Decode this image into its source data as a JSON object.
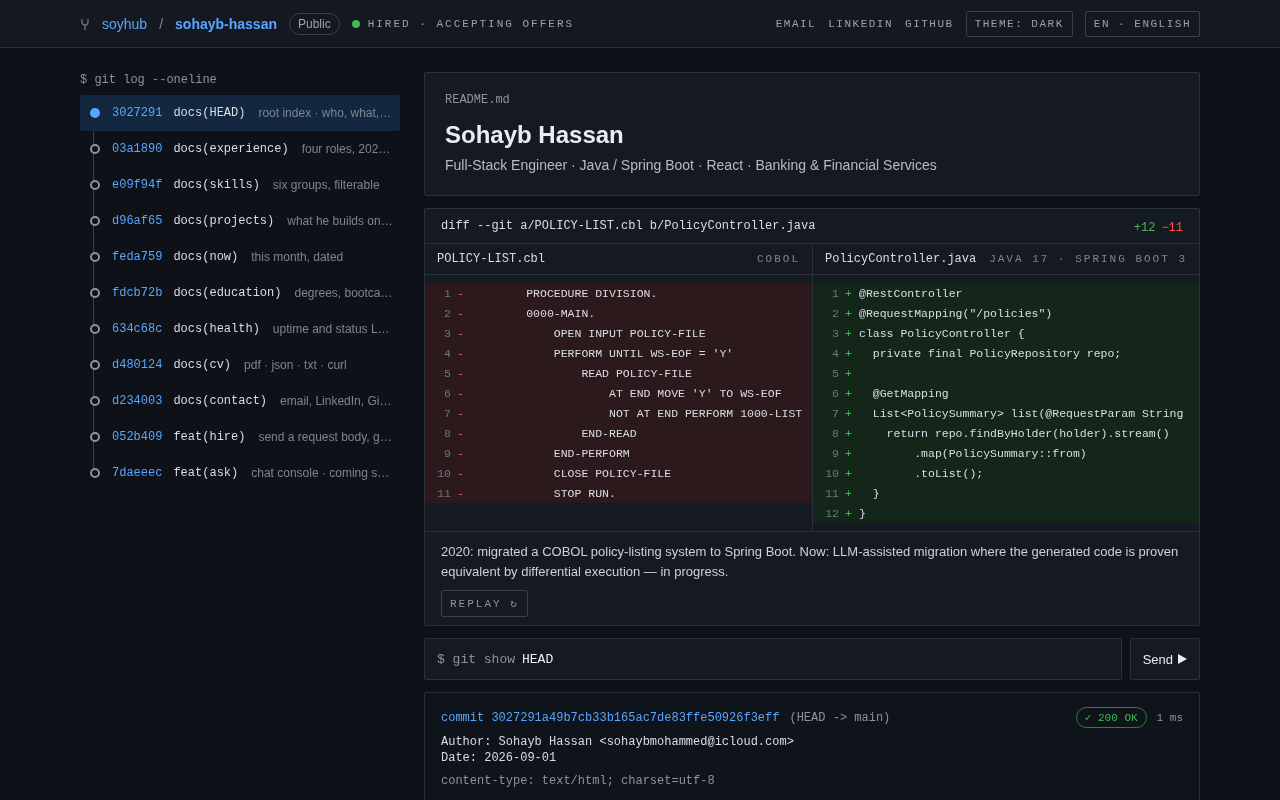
{
  "header": {
    "owner": "soyhub",
    "separator": "/",
    "repo": "sohayb-hassan",
    "visibility": "Public",
    "status": {
      "label": "HIRED · ACCEPTING OFFERS",
      "online": true
    },
    "links": [
      "EMAIL",
      "LINKEDIN",
      "GITHUB"
    ],
    "buttons": [
      "THEME: DARK",
      "EN · ENGLISH"
    ]
  },
  "sidebar": {
    "prompt": "$ git log --oneline",
    "commits": [
      {
        "hash": "3027291",
        "subject": "docs(HEAD)",
        "description": "root index · who, what,…",
        "selected": true
      },
      {
        "hash": "03a1890",
        "subject": "docs(experience)",
        "description": "four roles, 202…",
        "selected": false
      },
      {
        "hash": "e09f94f",
        "subject": "docs(skills)",
        "description": "six groups, filterable",
        "selected": false
      },
      {
        "hash": "d96af65",
        "subject": "docs(projects)",
        "description": "what he builds on…",
        "selected": false
      },
      {
        "hash": "feda759",
        "subject": "docs(now)",
        "description": "this month, dated",
        "selected": false
      },
      {
        "hash": "fdcb72b",
        "subject": "docs(education)",
        "description": "degrees, bootca…",
        "selected": false
      },
      {
        "hash": "634c68c",
        "subject": "docs(health)",
        "description": "uptime and status L…",
        "selected": false
      },
      {
        "hash": "d480124",
        "subject": "docs(cv)",
        "description": "pdf · json · txt · curl",
        "selected": false
      },
      {
        "hash": "d234003",
        "subject": "docs(contact)",
        "description": "email, LinkedIn, Gi…",
        "selected": false
      },
      {
        "hash": "052b409",
        "subject": "feat(hire)",
        "description": "send a request body, g…",
        "selected": false
      },
      {
        "hash": "7daeeec",
        "subject": "feat(ask)",
        "description": "chat console · coming s…",
        "selected": false
      }
    ]
  },
  "readme": {
    "filename": "README.md",
    "title": "Sohayb Hassan",
    "subtitle": "Full-Stack Engineer · Java / Spring Boot · React · Banking & Financial Services"
  },
  "diff": {
    "command": "diff --git a/POLICY-LIST.cbl b/PolicyController.java",
    "additions": "+12",
    "deletions": "−11",
    "left": {
      "filename": "POLICY-LIST.cbl",
      "language": "COBOL",
      "lines": [
        {
          "number": "1",
          "sign": "-",
          "code": "        PROCEDURE DIVISION."
        },
        {
          "number": "2",
          "sign": "-",
          "code": "        0000-MAIN."
        },
        {
          "number": "3",
          "sign": "-",
          "code": "            OPEN INPUT POLICY-FILE"
        },
        {
          "number": "4",
          "sign": "-",
          "code": "            PERFORM UNTIL WS-EOF = 'Y'"
        },
        {
          "number": "5",
          "sign": "-",
          "code": "                READ POLICY-FILE"
        },
        {
          "number": "6",
          "sign": "-",
          "code": "                    AT END MOVE 'Y' TO WS-EOF"
        },
        {
          "number": "7",
          "sign": "-",
          "code": "                    NOT AT END PERFORM 1000-LIST"
        },
        {
          "number": "8",
          "sign": "-",
          "code": "                END-READ"
        },
        {
          "number": "9",
          "sign": "-",
          "code": "            END-PERFORM"
        },
        {
          "number": "10",
          "sign": "-",
          "code": "            CLOSE POLICY-FILE"
        },
        {
          "number": "11",
          "sign": "-",
          "code": "            STOP RUN."
        }
      ]
    },
    "right": {
      "filename": "PolicyController.java",
      "language": "JAVA 17 · SPRING BOOT 3",
      "lines": [
        {
          "number": "1",
          "sign": "+",
          "code": "@RestController"
        },
        {
          "number": "2",
          "sign": "+",
          "code": "@RequestMapping(\"/policies\")"
        },
        {
          "number": "3",
          "sign": "+",
          "code": "class PolicyController {"
        },
        {
          "number": "4",
          "sign": "+",
          "code": "  private final PolicyRepository repo;"
        },
        {
          "number": "5",
          "sign": "+"
        },
        {
          "number": "6",
          "sign": "+",
          "code": "  @GetMapping"
        },
        {
          "number": "7",
          "sign": "+",
          "code": "  List<PolicySummary> list(@RequestParam String"
        },
        {
          "number": "8",
          "sign": "+",
          "code": "    return repo.findByHolder(holder).stream()"
        },
        {
          "number": "9",
          "sign": "+",
          "code": "        .map(PolicySummary::from)"
        },
        {
          "number": "10",
          "sign": "+",
          "code": "        .toList();"
        },
        {
          "number": "11",
          "sign": "+",
          "code": "  }"
        },
        {
          "number": "12",
          "sign": "+",
          "code": "}"
        }
      ]
    },
    "note": "2020: migrated a COBOL policy-listing system to Spring Boot. Now: LLM-assisted migration where the generated code is proven equivalent by differential execution — in progress.",
    "replay": "REPLAY ↻"
  },
  "console": {
    "prefix": "$ git show",
    "value": "HEAD",
    "send": "Send"
  },
  "commit": {
    "hash_line": "commit 3027291a49b7cb33b165ac7de83ffe50926f3eff",
    "ref": "(HEAD -> main)",
    "status": "✓ 200 OK",
    "time": "1 ms",
    "author": "Author: Sohayb Hassan <sohaybmohammed@icloud.com>",
    "date": "Date: 2026-09-01",
    "headers": [
      "content-type: text/html; charset=utf-8"
    ]
  }
}
